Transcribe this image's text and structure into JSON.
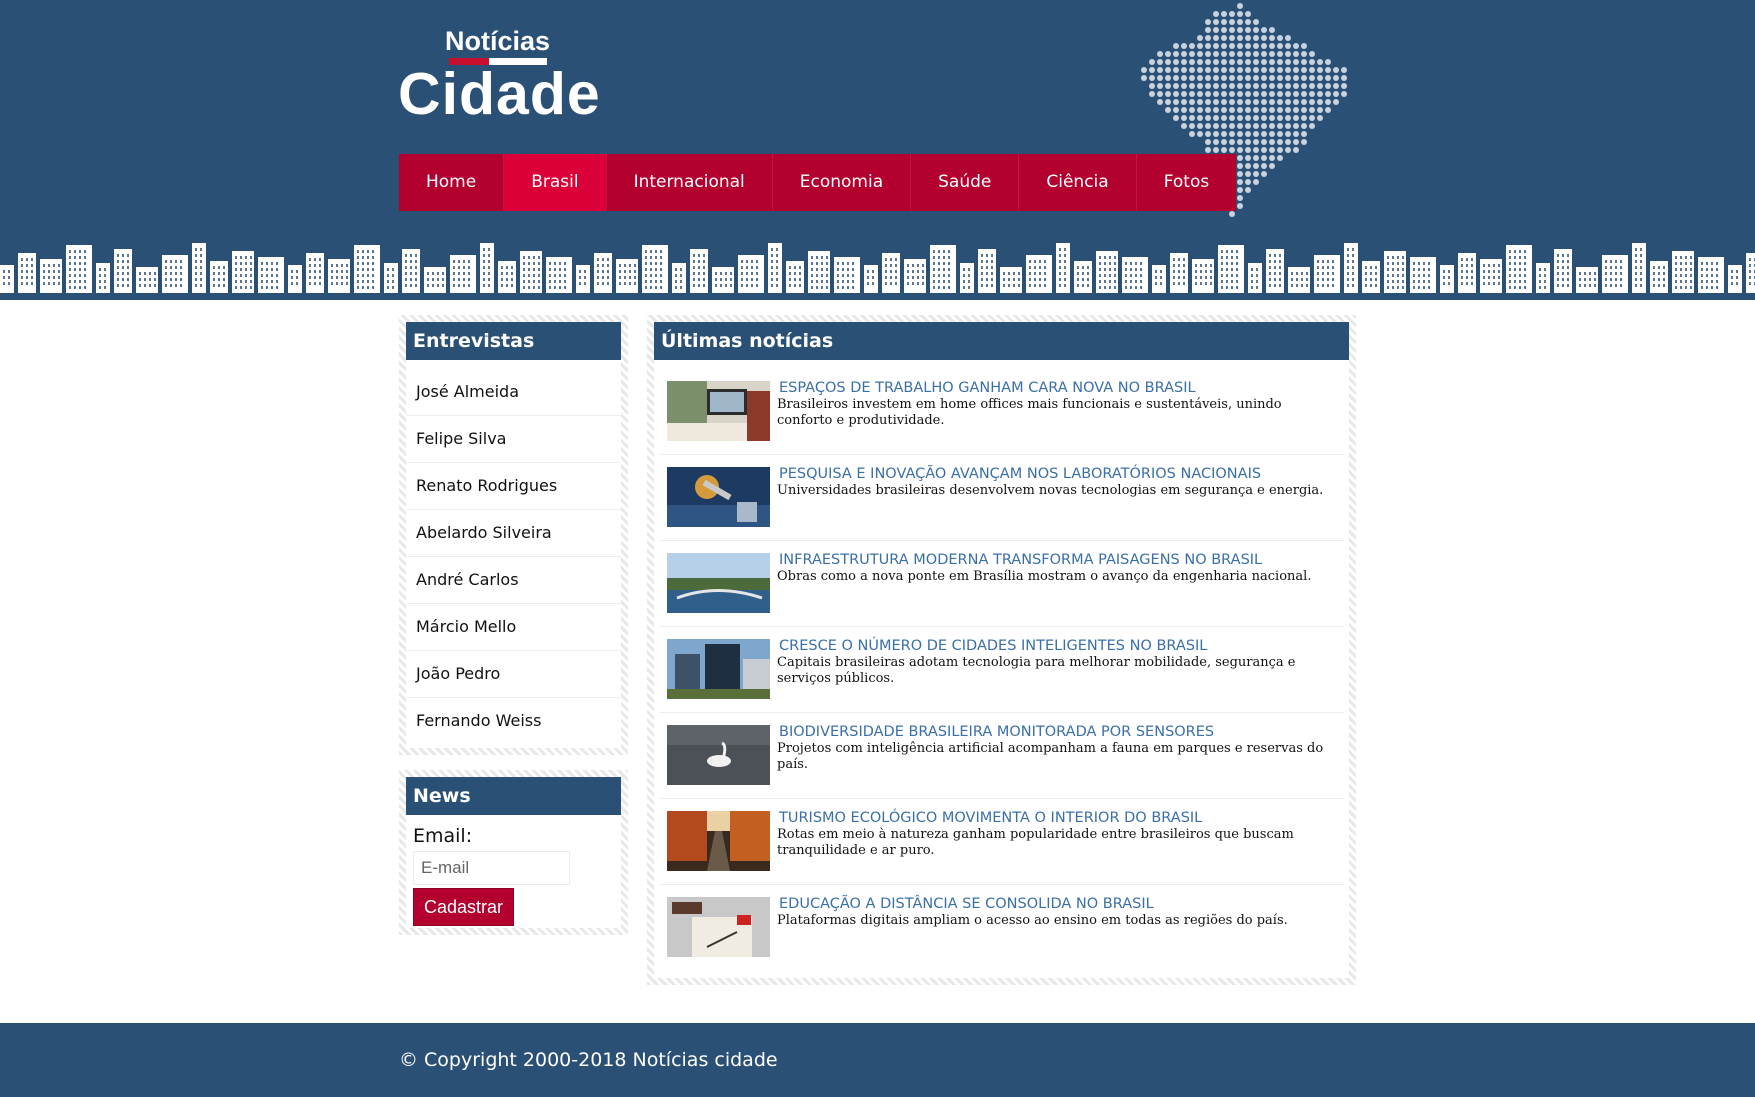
{
  "colors": {
    "header": "#2b5075",
    "nav": "#b4002f",
    "nav_active": "#dc0038",
    "link": "#3a6fa8"
  },
  "logo": {
    "top": "Notícias",
    "bottom": "Cidade"
  },
  "nav": {
    "items": [
      {
        "label": "Home"
      },
      {
        "label": "Brasil",
        "active": true
      },
      {
        "label": "Internacional"
      },
      {
        "label": "Economia"
      },
      {
        "label": "Saúde"
      },
      {
        "label": "Ciência"
      },
      {
        "label": "Fotos"
      }
    ]
  },
  "sidebar": {
    "interviews_title": "Entrevistas",
    "interviews": [
      "José Almeida",
      "Felipe Silva",
      "Renato Rodrigues",
      "Abelardo Silveira",
      "André Carlos",
      "Márcio Mello",
      "João Pedro",
      "Fernando Weiss"
    ],
    "news_title": "News",
    "email_label": "Email:",
    "email_placeholder": "E-mail",
    "submit_label": "Cadastrar"
  },
  "main": {
    "title": "Últimas notícias",
    "articles": [
      {
        "title": "ESPAÇOS DE TRABALHO GANHAM CARA NOVA NO BRASIL",
        "desc": "Brasileiros investem em home offices mais funcionais e sustentáveis, unindo conforto e produtividade.",
        "image": "home-office-photo"
      },
      {
        "title": "PESQUISA E INOVAÇÃO AVANÇAM NOS LABORATÓRIOS NACIONAIS",
        "desc": "Universidades brasileiras desenvolvem novas tecnologias em segurança e energia.",
        "image": "laboratory-photo"
      },
      {
        "title": "INFRAESTRUTURA MODERNA TRANSFORMA PAISAGENS NO BRASIL",
        "desc": "Obras como a nova ponte em Brasília mostram o avanço da engenharia nacional.",
        "image": "bridge-photo"
      },
      {
        "title": "CRESCE O NÚMERO DE CIDADES INTELIGENTES NO BRASIL",
        "desc": "Capitais brasileiras adotam tecnologia para melhorar mobilidade, segurança e serviços públicos.",
        "image": "modern-buildings-photo"
      },
      {
        "title": "BIODIVERSIDADE BRASILEIRA MONITORADA POR SENSORES",
        "desc": "Projetos com inteligência artificial acompanham a fauna em parques e reservas do país.",
        "image": "swan-lake-photo"
      },
      {
        "title": "TURISMO ECOLÓGICO MOVIMENTA O INTERIOR DO BRASIL",
        "desc": "Rotas em meio à natureza ganham popularidade entre brasileiros que buscam tranquilidade e ar puro.",
        "image": "autumn-road-photo"
      },
      {
        "title": "EDUCAÇÃO A DISTÂNCIA SE CONSOLIDA NO BRASIL",
        "desc": "Plataformas digitais ampliam o acesso ao ensino em todas as regiões do país.",
        "image": "desk-notebook-photo"
      }
    ]
  },
  "footer": {
    "copyright": "© Copyright 2000-2018 Notícias cidade"
  }
}
